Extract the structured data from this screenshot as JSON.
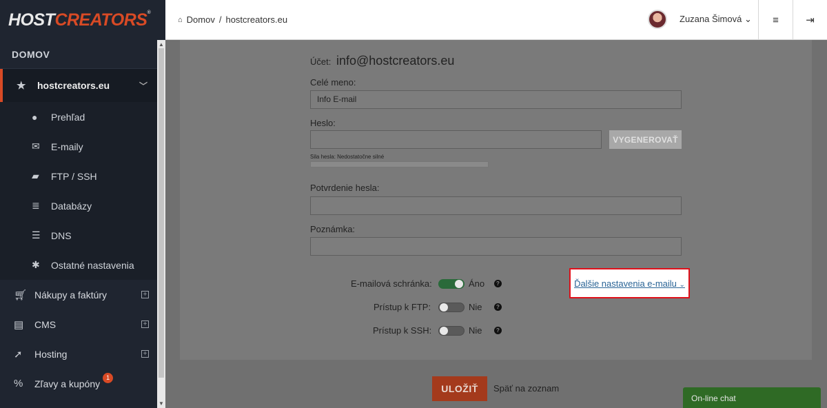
{
  "logo": {
    "host": "HOST",
    "creators": "CREATORS",
    "mark": "®"
  },
  "breadcrumb": {
    "home": "Domov",
    "separator": "/",
    "current": "hostcreators.eu"
  },
  "user": {
    "name": "Zuzana Šimová",
    "chevron": "⌄"
  },
  "topbar": {
    "menu_icon": "≡",
    "logout_icon": "⇥"
  },
  "sidebar": {
    "title": "DOMOV",
    "domain": "hostcreators.eu",
    "sub_items": [
      {
        "label": "Prehľad",
        "icon": "globe-icon"
      },
      {
        "label": "E-maily",
        "icon": "envelope-icon"
      },
      {
        "label": "FTP / SSH",
        "icon": "folder-icon"
      },
      {
        "label": "Databázy",
        "icon": "database-icon"
      },
      {
        "label": "DNS",
        "icon": "server-icon"
      },
      {
        "label": "Ostatné nastavenia",
        "icon": "gear-icon"
      }
    ],
    "items": [
      {
        "label": "Nákupy a faktúry",
        "icon": "cart-icon"
      },
      {
        "label": "CMS",
        "icon": "file-icon"
      },
      {
        "label": "Hosting",
        "icon": "rocket-icon"
      },
      {
        "label": "Zľavy a kupóny",
        "icon": "percent-icon",
        "badge": "1"
      }
    ]
  },
  "form": {
    "account_label": "Účet:",
    "account_value": "info@hostcreators.eu",
    "fullname_label": "Celé meno:",
    "fullname_value": "Info E-mail",
    "password_label": "Heslo:",
    "password_value": "",
    "generate_label": "VYGENEROVAŤ",
    "strength_text": "Sila hesla: Nedostatočne silné",
    "confirm_label": "Potvrdenie hesla:",
    "confirm_value": "",
    "note_label": "Poznámka:",
    "note_value": "",
    "toggles": [
      {
        "label": "E-mailová schránka:",
        "state": "Áno",
        "on": true
      },
      {
        "label": "Prístup k FTP:",
        "state": "Nie",
        "on": false
      },
      {
        "label": "Prístup k SSH:",
        "state": "Nie",
        "on": false
      }
    ],
    "help_glyph": "?",
    "more_settings": "Ďalšie nastavenia e-mailu",
    "save": "ULOŽIŤ",
    "back": "Späť na zoznam"
  },
  "chat": {
    "label": "On-line chat"
  },
  "colors": {
    "accent": "#d84a25",
    "sidebar": "#1f2530",
    "toggle_on": "#2a6a3a",
    "highlight": "#e0101a"
  }
}
